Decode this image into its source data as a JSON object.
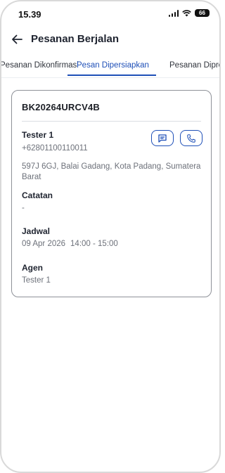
{
  "status_bar": {
    "time": "15.39",
    "battery": "66"
  },
  "header": {
    "title": "Pesanan Berjalan"
  },
  "tabs": [
    {
      "label": "Pesanan Dikonfirmasi",
      "active": false
    },
    {
      "label": "Pesan Dipersiapkan",
      "active": true
    },
    {
      "label": "Pesanan Diproses",
      "active": false
    }
  ],
  "order": {
    "id": "BK20264URCV4B",
    "customer_name": "Tester 1",
    "phone": "+62801100110011",
    "address": "597J 6GJ, Balai Gadang, Kota Padang, Sumatera Barat",
    "notes_label": "Catatan",
    "notes_value": "-",
    "schedule_label": "Jadwal",
    "schedule_date": "09 Apr 2026",
    "schedule_time": "14:00 - 15:00",
    "agent_label": "Agen",
    "agent_value": "Tester 1"
  },
  "colors": {
    "accent": "#1e4fb7",
    "text": "#1f2430",
    "muted": "#6d717a",
    "border": "#8e9198"
  }
}
